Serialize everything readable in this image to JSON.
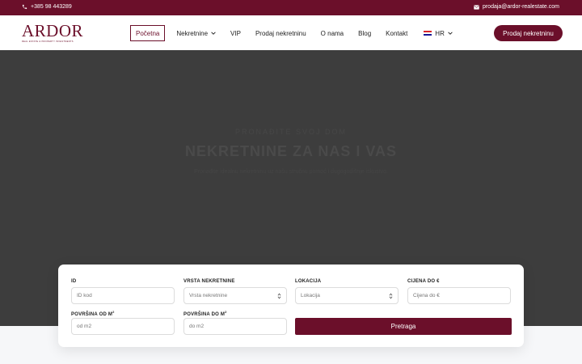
{
  "topbar": {
    "phone": "+385 98 443289",
    "email": "prodaja@ardor-realestate.com",
    "icons": [
      "phone-icon",
      "envelope-icon"
    ]
  },
  "header": {
    "logo_word": "ARDOR",
    "logo_tagline": "REAL ESTATE & PROPERTY INVESTMENTS",
    "nav": [
      {
        "label": "Početna",
        "active": true
      },
      {
        "label": "Nekretnine",
        "dropdown": true
      },
      {
        "label": "VIP"
      },
      {
        "label": "Prodaj nekretninu"
      },
      {
        "label": "O nama"
      },
      {
        "label": "Blog"
      },
      {
        "label": "Kontakt"
      },
      {
        "label": "HR",
        "dropdown": true,
        "flag": "croatia-flag-icon"
      }
    ],
    "cta_label": "Prodaj nekretninu"
  },
  "hero": {
    "eyebrow": "PRONAĐITE SVOJ DOM",
    "title": "NEKRETNINE ZA NAS I VAS",
    "subtitle": "Pronađite idealnu nekretninu uz našu stručnu pomoć i dugogodišnje iskustvo."
  },
  "search": {
    "id_label": "ID",
    "id_placeholder": "ID kod",
    "type_label": "VRSTA NEKRETNINE",
    "type_value": "Vrsta nekretnine",
    "location_label": "LOKACIJA",
    "location_value": "Lokacija",
    "price_label": "CIJENA DO €",
    "price_placeholder": "Cijena do €",
    "area_from_label": "POVRŠINA OD M",
    "area_from_placeholder": "od m2",
    "area_to_label": "POVRŠINA DO M",
    "area_to_placeholder": "do m2",
    "area_unit_sup": "2",
    "submit_label": "Pretraga"
  },
  "colors": {
    "brand": "#6b0f2a",
    "hero_bg": "#3d3d3d",
    "page_bg": "#f6f7f9"
  }
}
